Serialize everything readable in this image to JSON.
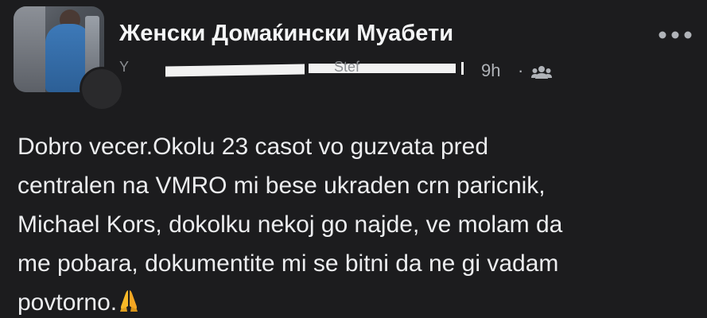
{
  "post": {
    "group_name": "Женски Домаќински Муабети",
    "author_partial_left": "Y",
    "author_partial_right": "Stef",
    "time": "9h",
    "separator": "·",
    "audience_icon": "group-icon",
    "more_icon": "more-options-icon",
    "body_text": "Dobro vecer.Okolu 23 casot vo guzvata pred\ncentralen na VMRO mi bese ukraden crn paricnik,\nMichael Kors, dokolku nekoj go najde, ve molam da\nme pobara, dokumentite mi se bitni da ne gi vadam\npovtorno.",
    "emoji": "folded-hands"
  },
  "colors": {
    "background": "#1c1c1e",
    "text": "#ecedef",
    "secondary_text": "#b0b3b8",
    "accent_emoji": "#f7b928"
  }
}
